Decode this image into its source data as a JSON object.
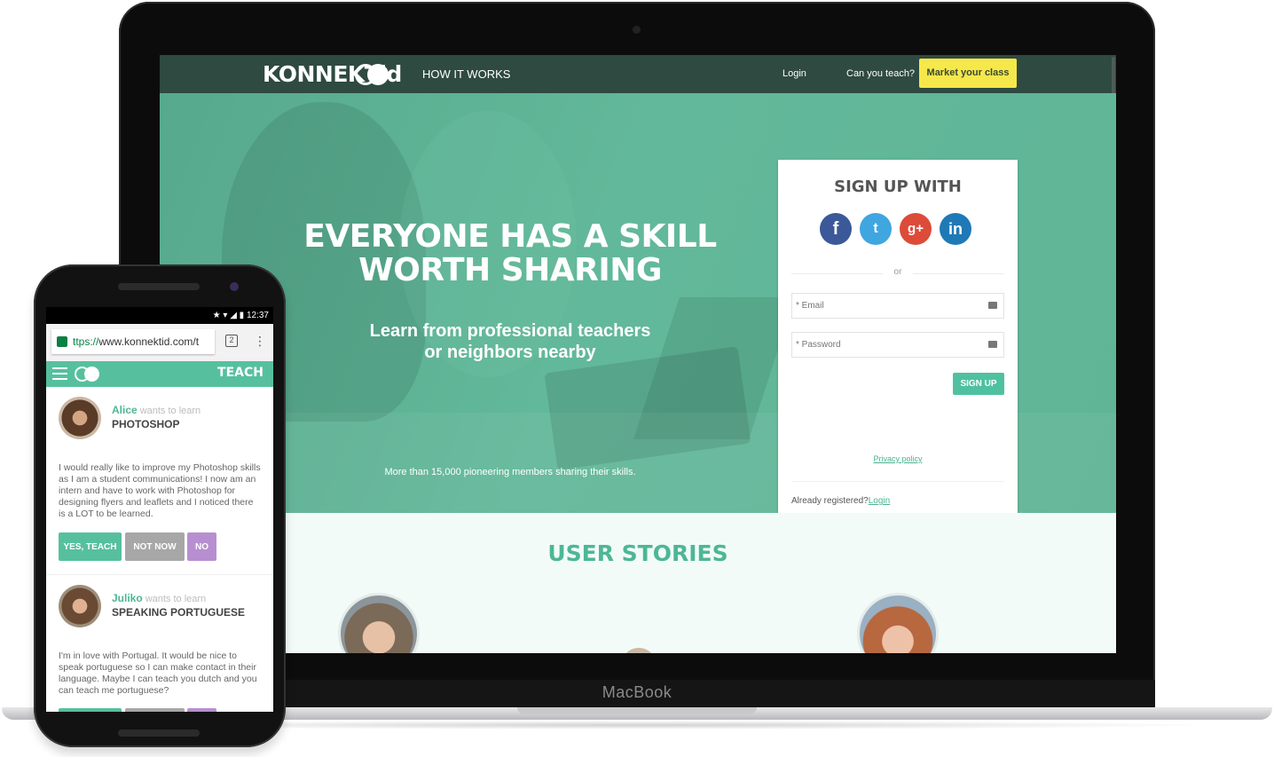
{
  "laptop": {
    "brand_label": "MacBook"
  },
  "desktop": {
    "nav": {
      "logo_text": "KONNEKTid",
      "how_it_works": "HOW IT WORKS",
      "login": "Login",
      "can_you_teach": "Can you teach?",
      "cta": "Market your class"
    },
    "hero": {
      "title_line1": "EVERYONE HAS A SKILL",
      "title_line2": "WORTH SHARING",
      "subtitle_line1": "Learn from professional teachers",
      "subtitle_line2": "or neighbors nearby",
      "members": "More than 15,000 pioneering members sharing their skills."
    },
    "signup": {
      "title": "SIGN UP WITH",
      "social": {
        "facebook": "f",
        "twitter": "t",
        "googleplus": "g+",
        "linkedin": "in"
      },
      "or": "or",
      "email_placeholder": "* Email",
      "password_placeholder": "* Password",
      "button": "SIGN UP",
      "privacy": "Privacy policy",
      "already": "Already registered?",
      "already_link": "Login"
    },
    "stories": {
      "title": "USER STORIES"
    }
  },
  "phone": {
    "status": {
      "time": "12:37",
      "icons": "★ ▾ ◢ ▮"
    },
    "browser": {
      "url_scheme": "ttps://",
      "url_rest": "www.konnektid.com/t",
      "tab_count": "2",
      "menu": "⋮"
    },
    "app": {
      "teach": "TEACH"
    },
    "cards": [
      {
        "name": "Alice",
        "wants": "wants to learn",
        "subject": "PHOTOSHOP",
        "message": "I would really like to improve my Photoshop skills as I am a student communications! I now am an intern and have to work with Photoshop for designing flyers and leaflets and I noticed there is a LOT to be learned.",
        "yes": "YES, TEACH",
        "not_now": "NOT NOW",
        "no": "NO"
      },
      {
        "name": "Juliko",
        "wants": "wants to learn",
        "subject": "SPEAKING PORTUGUESE",
        "message": "I'm in love with Portugal. It would be nice to speak portuguese so I can make contact in their language. Maybe I can teach you dutch and you can teach me portuguese?"
      }
    ]
  },
  "colors": {
    "accent": "#56c09e",
    "nav_dark": "#2f4a40",
    "cta_yellow": "#f6e84b"
  }
}
